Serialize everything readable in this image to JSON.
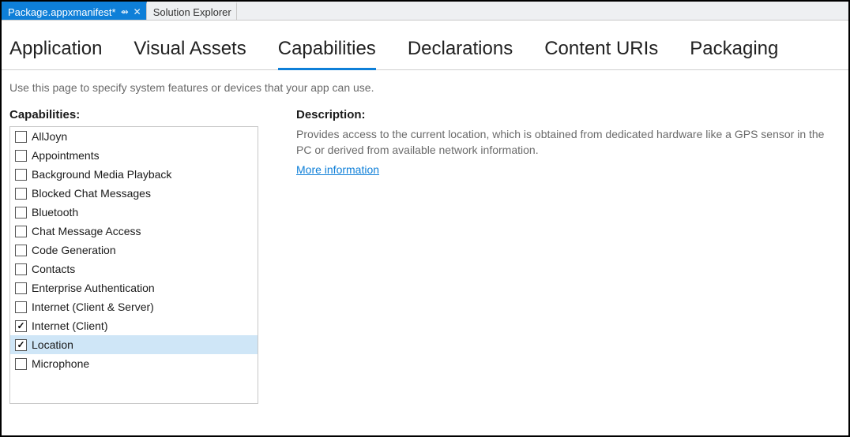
{
  "editor_tabs": [
    {
      "label": "Package.appxmanifest*",
      "active": true,
      "pinned": true,
      "closable": true
    },
    {
      "label": "Solution Explorer",
      "active": false,
      "pinned": false,
      "closable": false
    }
  ],
  "manifest_tabs": [
    {
      "label": "Application",
      "selected": false
    },
    {
      "label": "Visual Assets",
      "selected": false
    },
    {
      "label": "Capabilities",
      "selected": true
    },
    {
      "label": "Declarations",
      "selected": false
    },
    {
      "label": "Content URIs",
      "selected": false
    },
    {
      "label": "Packaging",
      "selected": false
    }
  ],
  "hint": "Use this page to specify system features or devices that your app can use.",
  "left": {
    "heading": "Capabilities:",
    "items": [
      {
        "label": "AllJoyn",
        "checked": false,
        "selected": false
      },
      {
        "label": "Appointments",
        "checked": false,
        "selected": false
      },
      {
        "label": "Background Media Playback",
        "checked": false,
        "selected": false
      },
      {
        "label": "Blocked Chat Messages",
        "checked": false,
        "selected": false
      },
      {
        "label": "Bluetooth",
        "checked": false,
        "selected": false
      },
      {
        "label": "Chat Message Access",
        "checked": false,
        "selected": false
      },
      {
        "label": "Code Generation",
        "checked": false,
        "selected": false
      },
      {
        "label": "Contacts",
        "checked": false,
        "selected": false
      },
      {
        "label": "Enterprise Authentication",
        "checked": false,
        "selected": false
      },
      {
        "label": "Internet (Client & Server)",
        "checked": false,
        "selected": false
      },
      {
        "label": "Internet (Client)",
        "checked": true,
        "selected": false
      },
      {
        "label": "Location",
        "checked": true,
        "selected": true
      },
      {
        "label": "Microphone",
        "checked": false,
        "selected": false
      }
    ]
  },
  "right": {
    "heading": "Description:",
    "text": "Provides access to the current location, which is obtained from dedicated hardware like a GPS sensor in the PC or derived from available network information.",
    "more": "More information"
  }
}
